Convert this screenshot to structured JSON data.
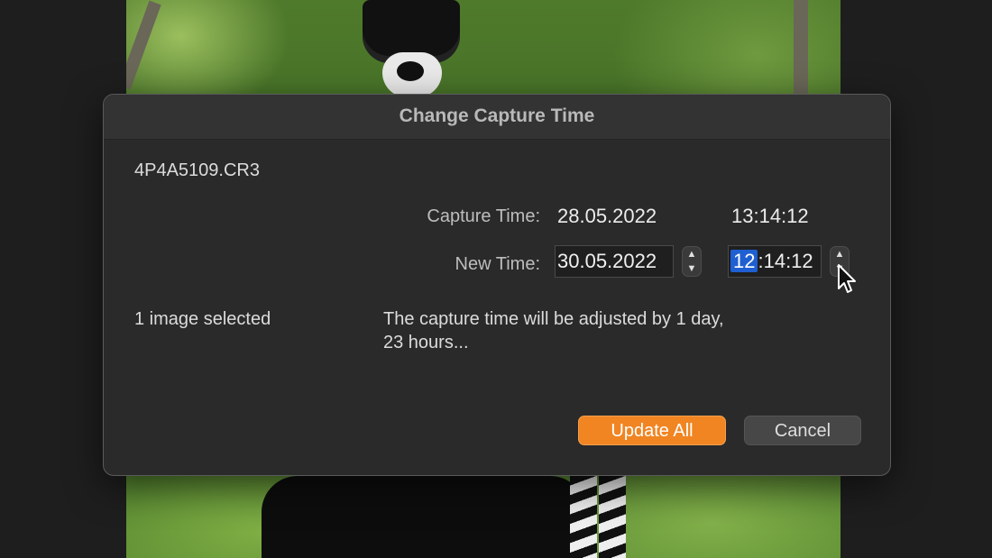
{
  "dialog": {
    "title": "Change Capture Time",
    "filename": "4P4A5109.CR3",
    "capture_time": {
      "label": "Capture Time:",
      "date": "28.05.2022",
      "time": "13:14:12"
    },
    "new_time": {
      "label": "New Time:",
      "date": "30.05.2022",
      "time_hour": "12",
      "time_rest": ":14:12"
    },
    "selection_status": "1 image selected",
    "adjustment_line1": "The capture time will be adjusted by 1 day,",
    "adjustment_line2": "23 hours...",
    "buttons": {
      "primary": "Update All",
      "secondary": "Cancel"
    }
  },
  "icons": {
    "stepper_up": "chevron-up-icon",
    "stepper_down": "chevron-down-icon",
    "cursor": "pointer-cursor-icon"
  },
  "colors": {
    "accent": "#f08522",
    "selection": "#1f5fd1",
    "dialog_bg": "#2a2a2a"
  }
}
